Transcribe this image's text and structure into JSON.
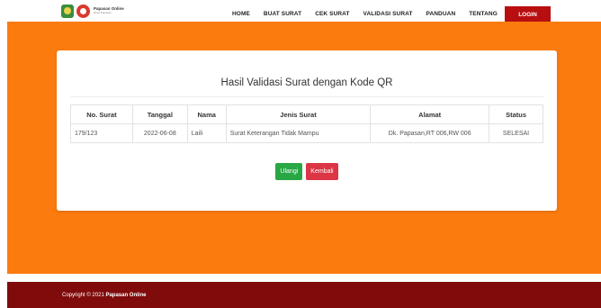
{
  "brand": {
    "name": "Papasan Online",
    "subtitle": "Desa Papasan"
  },
  "nav": {
    "items": [
      "HOME",
      "BUAT SURAT",
      "CEK SURAT",
      "VALIDASI SURAT",
      "PANDUAN",
      "TENTANG"
    ],
    "login": "LOGIN"
  },
  "colors": {
    "accent": "#fc7b0e",
    "login": "#b80e10",
    "footer": "#7f0b0b",
    "success": "#28a745",
    "danger": "#dc3545"
  },
  "card": {
    "title": "Hasil Validasi Surat dengan Kode QR",
    "table": {
      "headers": [
        "No. Surat",
        "Tanggal",
        "Nama",
        "Jenis Surat",
        "Alamat",
        "Status"
      ],
      "rows": [
        [
          "179/123",
          "2022-06-08",
          "Laili",
          "Surat Keterangan Tidak Mampu",
          "Dk. Papasan,RT 006,RW 006",
          "SELESAI"
        ]
      ]
    },
    "buttons": {
      "retry": "Ulangi",
      "back": "Kembali"
    }
  },
  "footer": {
    "prefix": "Copyright © 2021",
    "brand": "Papasan Online"
  }
}
